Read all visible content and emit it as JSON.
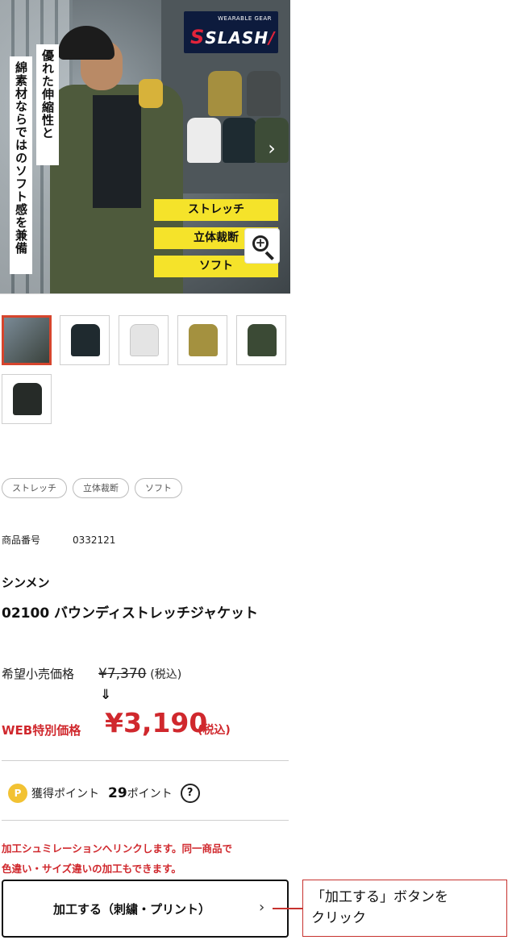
{
  "hero": {
    "brand_top": "WEARABLE GEAR",
    "brand_s": "S",
    "brand_main": "SLASH",
    "brand_slash": "/",
    "vertical_text_1": "優れた伸縮性と",
    "vertical_text_2": "綿素材ならではのソフト感を兼備",
    "next_arrow": "›",
    "tags": [
      "ストレッチ",
      "立体裁断",
      "ソフト"
    ],
    "zoom_icon": "zoom-in-icon"
  },
  "thumbnails": {
    "colors": [
      "#5a6a70",
      "#1f2a2f",
      "#e9e9e9",
      "#a4913f",
      "#3b4a35",
      "#262b28"
    ]
  },
  "chips": [
    "ストレッチ",
    "立体裁断",
    "ソフト"
  ],
  "product": {
    "sku_label": "商品番号",
    "sku": "0332121",
    "maker": "シンメン",
    "name": "02100 バウンディストレッチジャケット"
  },
  "price": {
    "msrp_label": "希望小売価格",
    "msrp_value": "¥7,370",
    "msrp_tax": "(税込)",
    "arrow": "⇓",
    "web_label": "WEB特別価格",
    "web_value": "¥3,190",
    "web_tax": "(税込)"
  },
  "points": {
    "badge": "P",
    "label": "獲得ポイント",
    "value": "29",
    "unit": "ポイント",
    "help": "?"
  },
  "notice": {
    "line1": "加工シュミレーションへリンクします。同一商品で",
    "line2": "色違い・サイズ違いの加工もできます。"
  },
  "process_button": {
    "label": "加工する（刺繍・プリント）",
    "chevron": "›"
  },
  "callout": {
    "line1": "「加工する」ボタンを",
    "line2": "クリック"
  },
  "colors": {
    "accent_red": "#d0282d",
    "tag_yellow": "#f5e32a",
    "brand_navy": "#0d1b3d"
  }
}
